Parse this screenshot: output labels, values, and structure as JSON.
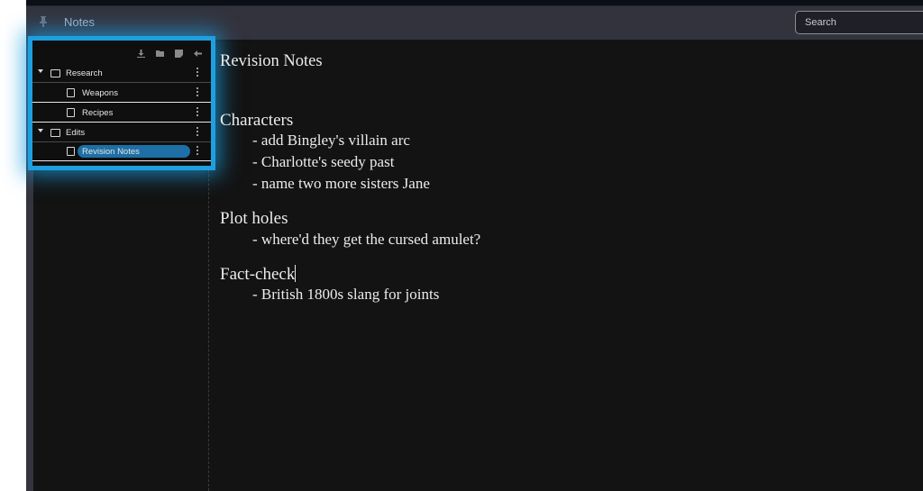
{
  "header": {
    "pin_icon": "pin-icon",
    "title": "Notes",
    "search_placeholder": "Search"
  },
  "tree_toolbar": {
    "icons": [
      "download-icon",
      "new-folder-icon",
      "new-note-icon",
      "collapse-icon"
    ]
  },
  "tree": [
    {
      "type": "folder",
      "label": "Research",
      "expanded": true
    },
    {
      "type": "note",
      "label": "Weapons"
    },
    {
      "type": "note",
      "label": "Recipes"
    },
    {
      "type": "folder",
      "label": "Edits",
      "expanded": true
    },
    {
      "type": "note",
      "label": "Revision Notes",
      "selected": true
    }
  ],
  "accent_color": "#1e9fe0",
  "selected_color": "#1d6fa5",
  "document": {
    "title": "Revision Notes",
    "sections": [
      {
        "heading": "Characters",
        "items": [
          "- add Bingley's villain arc",
          "- Charlotte's seedy past",
          "- name two more sisters Jane"
        ]
      },
      {
        "heading": "Plot holes",
        "items": [
          "- where'd they get the cursed amulet?"
        ]
      },
      {
        "heading": "Fact-check",
        "items": [
          "- British 1800s slang for joints"
        ]
      }
    ]
  }
}
